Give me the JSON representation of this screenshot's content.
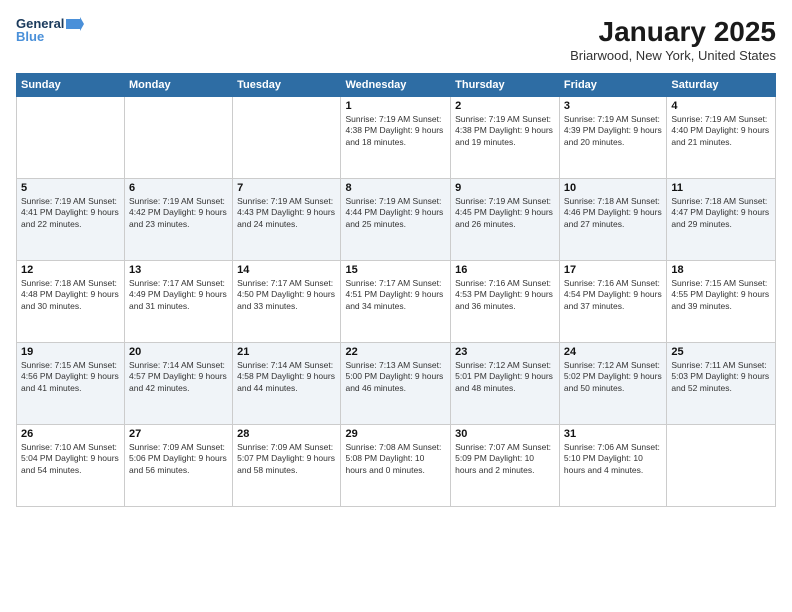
{
  "logo": {
    "line1": "General",
    "line2": "Blue"
  },
  "title": "January 2025",
  "location": "Briarwood, New York, United States",
  "weekdays": [
    "Sunday",
    "Monday",
    "Tuesday",
    "Wednesday",
    "Thursday",
    "Friday",
    "Saturday"
  ],
  "weeks": [
    [
      {
        "day": "",
        "info": ""
      },
      {
        "day": "",
        "info": ""
      },
      {
        "day": "",
        "info": ""
      },
      {
        "day": "1",
        "info": "Sunrise: 7:19 AM\nSunset: 4:38 PM\nDaylight: 9 hours\nand 18 minutes."
      },
      {
        "day": "2",
        "info": "Sunrise: 7:19 AM\nSunset: 4:38 PM\nDaylight: 9 hours\nand 19 minutes."
      },
      {
        "day": "3",
        "info": "Sunrise: 7:19 AM\nSunset: 4:39 PM\nDaylight: 9 hours\nand 20 minutes."
      },
      {
        "day": "4",
        "info": "Sunrise: 7:19 AM\nSunset: 4:40 PM\nDaylight: 9 hours\nand 21 minutes."
      }
    ],
    [
      {
        "day": "5",
        "info": "Sunrise: 7:19 AM\nSunset: 4:41 PM\nDaylight: 9 hours\nand 22 minutes."
      },
      {
        "day": "6",
        "info": "Sunrise: 7:19 AM\nSunset: 4:42 PM\nDaylight: 9 hours\nand 23 minutes."
      },
      {
        "day": "7",
        "info": "Sunrise: 7:19 AM\nSunset: 4:43 PM\nDaylight: 9 hours\nand 24 minutes."
      },
      {
        "day": "8",
        "info": "Sunrise: 7:19 AM\nSunset: 4:44 PM\nDaylight: 9 hours\nand 25 minutes."
      },
      {
        "day": "9",
        "info": "Sunrise: 7:19 AM\nSunset: 4:45 PM\nDaylight: 9 hours\nand 26 minutes."
      },
      {
        "day": "10",
        "info": "Sunrise: 7:18 AM\nSunset: 4:46 PM\nDaylight: 9 hours\nand 27 minutes."
      },
      {
        "day": "11",
        "info": "Sunrise: 7:18 AM\nSunset: 4:47 PM\nDaylight: 9 hours\nand 29 minutes."
      }
    ],
    [
      {
        "day": "12",
        "info": "Sunrise: 7:18 AM\nSunset: 4:48 PM\nDaylight: 9 hours\nand 30 minutes."
      },
      {
        "day": "13",
        "info": "Sunrise: 7:17 AM\nSunset: 4:49 PM\nDaylight: 9 hours\nand 31 minutes."
      },
      {
        "day": "14",
        "info": "Sunrise: 7:17 AM\nSunset: 4:50 PM\nDaylight: 9 hours\nand 33 minutes."
      },
      {
        "day": "15",
        "info": "Sunrise: 7:17 AM\nSunset: 4:51 PM\nDaylight: 9 hours\nand 34 minutes."
      },
      {
        "day": "16",
        "info": "Sunrise: 7:16 AM\nSunset: 4:53 PM\nDaylight: 9 hours\nand 36 minutes."
      },
      {
        "day": "17",
        "info": "Sunrise: 7:16 AM\nSunset: 4:54 PM\nDaylight: 9 hours\nand 37 minutes."
      },
      {
        "day": "18",
        "info": "Sunrise: 7:15 AM\nSunset: 4:55 PM\nDaylight: 9 hours\nand 39 minutes."
      }
    ],
    [
      {
        "day": "19",
        "info": "Sunrise: 7:15 AM\nSunset: 4:56 PM\nDaylight: 9 hours\nand 41 minutes."
      },
      {
        "day": "20",
        "info": "Sunrise: 7:14 AM\nSunset: 4:57 PM\nDaylight: 9 hours\nand 42 minutes."
      },
      {
        "day": "21",
        "info": "Sunrise: 7:14 AM\nSunset: 4:58 PM\nDaylight: 9 hours\nand 44 minutes."
      },
      {
        "day": "22",
        "info": "Sunrise: 7:13 AM\nSunset: 5:00 PM\nDaylight: 9 hours\nand 46 minutes."
      },
      {
        "day": "23",
        "info": "Sunrise: 7:12 AM\nSunset: 5:01 PM\nDaylight: 9 hours\nand 48 minutes."
      },
      {
        "day": "24",
        "info": "Sunrise: 7:12 AM\nSunset: 5:02 PM\nDaylight: 9 hours\nand 50 minutes."
      },
      {
        "day": "25",
        "info": "Sunrise: 7:11 AM\nSunset: 5:03 PM\nDaylight: 9 hours\nand 52 minutes."
      }
    ],
    [
      {
        "day": "26",
        "info": "Sunrise: 7:10 AM\nSunset: 5:04 PM\nDaylight: 9 hours\nand 54 minutes."
      },
      {
        "day": "27",
        "info": "Sunrise: 7:09 AM\nSunset: 5:06 PM\nDaylight: 9 hours\nand 56 minutes."
      },
      {
        "day": "28",
        "info": "Sunrise: 7:09 AM\nSunset: 5:07 PM\nDaylight: 9 hours\nand 58 minutes."
      },
      {
        "day": "29",
        "info": "Sunrise: 7:08 AM\nSunset: 5:08 PM\nDaylight: 10 hours\nand 0 minutes."
      },
      {
        "day": "30",
        "info": "Sunrise: 7:07 AM\nSunset: 5:09 PM\nDaylight: 10 hours\nand 2 minutes."
      },
      {
        "day": "31",
        "info": "Sunrise: 7:06 AM\nSunset: 5:10 PM\nDaylight: 10 hours\nand 4 minutes."
      },
      {
        "day": "",
        "info": ""
      }
    ]
  ]
}
